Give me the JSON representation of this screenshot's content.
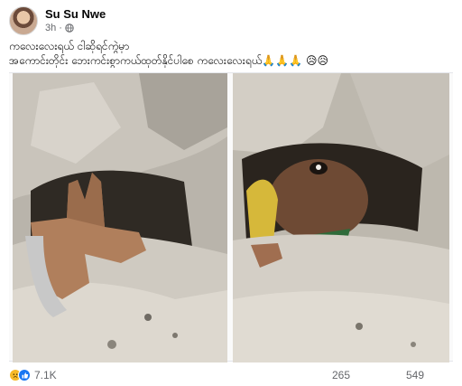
{
  "post": {
    "author": "Su Su Nwe",
    "time": "3h",
    "caption_line1": "ကလေးလေးရယ် ငါဆိုရင်ကွဲမှာ",
    "caption_line2": "အကောင်းတိုင်း ဘေးကင်းစွာကယ်ထုတ်နိုင်ပါစေ ကလေးလေးရယ်🙏🙏🙏 😥😥"
  },
  "stats": {
    "reactions_count": "7.1K",
    "comments_count": "265",
    "shares_count": "549"
  },
  "icons": {
    "globe": "globe-icon",
    "sad_reaction": "sad-reaction-icon",
    "like_reaction": "like-reaction-icon"
  },
  "colors": {
    "like_blue": "#1877f2",
    "sad_yellow": "#f7b928",
    "secondary_text": "#65676b"
  }
}
